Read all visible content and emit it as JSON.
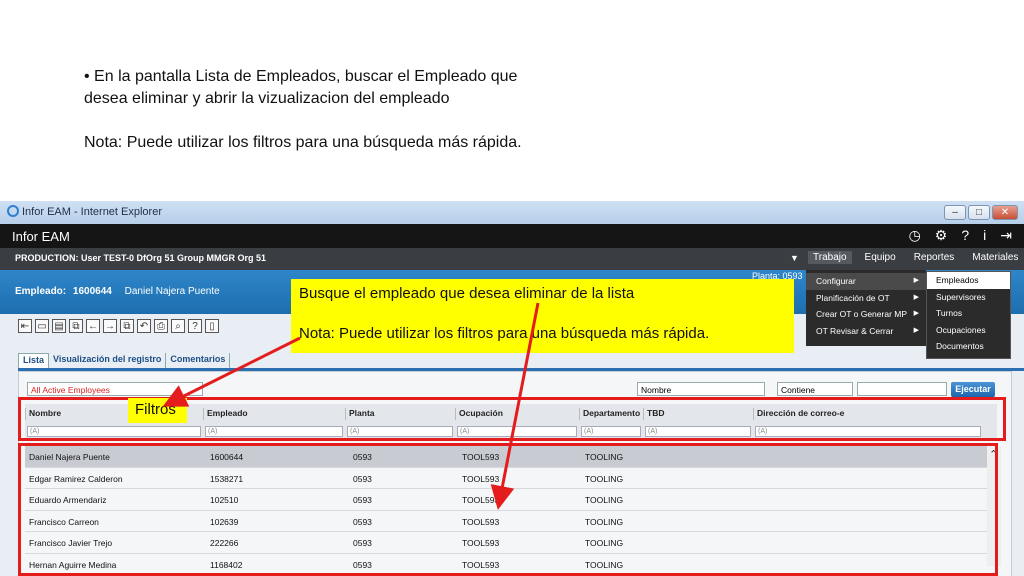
{
  "slide": {
    "bullet": "• En la pantalla Lista de Empleados, buscar  el Empleado que desea eliminar y abrir la vizualizacion del empleado",
    "note": "Nota: Puede  utilizar los filtros para una búsqueda más rápida."
  },
  "window": {
    "title": "Infor EAM - Internet Explorer",
    "minimize": "–",
    "maximize": "□",
    "close": "✕"
  },
  "app": {
    "brand": "Infor EAM",
    "icons": {
      "clock": "◷",
      "gear": "⚙",
      "help": "?",
      "info": "i",
      "logout": "⇥"
    }
  },
  "context": {
    "text": "PRODUCTION: User TEST-0 DfOrg 51 Group MMGR Org 51",
    "menus": [
      "Trabajo",
      "Equipo",
      "Reportes",
      "Materiales"
    ]
  },
  "header": {
    "label": "Empleado:",
    "code": "1600644",
    "name": "Daniel Najera Puente",
    "planta": "Planta: 0593"
  },
  "toolbar": [
    "⇤",
    "▭",
    "▤",
    "⧉",
    "←",
    "→",
    "⧉",
    "↶",
    "⎙",
    "⌕",
    "?",
    "▯"
  ],
  "tabs": [
    "Lista",
    "Visualización del registro",
    "Comentarios"
  ],
  "filters": {
    "dataspy": "All Active Employees",
    "field": "Nombre",
    "operator": "Contiene",
    "value": "",
    "execute": "Ejecutar"
  },
  "columns": [
    "Nombre",
    "Empleado",
    "Planta",
    "Ocupación",
    "Departamento",
    "TBD",
    "Dirección de correo-e"
  ],
  "filter_prefix": "(A)",
  "rows": [
    [
      "Daniel Najera Puente",
      "1600644",
      "0593",
      "TOOL593",
      "TOOLING"
    ],
    [
      "Edgar Ramirez Calderon",
      "1538271",
      "0593",
      "TOOL593",
      "TOOLING"
    ],
    [
      "Eduardo Armendariz",
      "102510",
      "0593",
      "TOOL593",
      "TOOLING"
    ],
    [
      "Francisco Carreon",
      "102639",
      "0593",
      "TOOL593",
      "TOOLING"
    ],
    [
      "Francisco Javier Trejo",
      "222266",
      "0593",
      "TOOL593",
      "TOOLING"
    ],
    [
      "Hernan Aguirre Medina",
      "1168402",
      "0593",
      "TOOL593",
      "TOOLING"
    ]
  ],
  "dropdown": [
    "Configurar",
    "Planificación de OT",
    "Crear OT o Generar MP",
    "OT Revisar & Cerrar"
  ],
  "submenu": [
    "Empleados",
    "Supervisores",
    "Turnos",
    "Ocupaciones",
    "Documentos"
  ],
  "callout": {
    "line1": "Busque el empleado que desea eliminar de la lista",
    "line2": "Nota: Puede  utilizar los filtros para una búsqueda más rápida."
  },
  "filtros_label": "Filtros",
  "accent": "#e41c1c",
  "highlight": "#ffff00"
}
